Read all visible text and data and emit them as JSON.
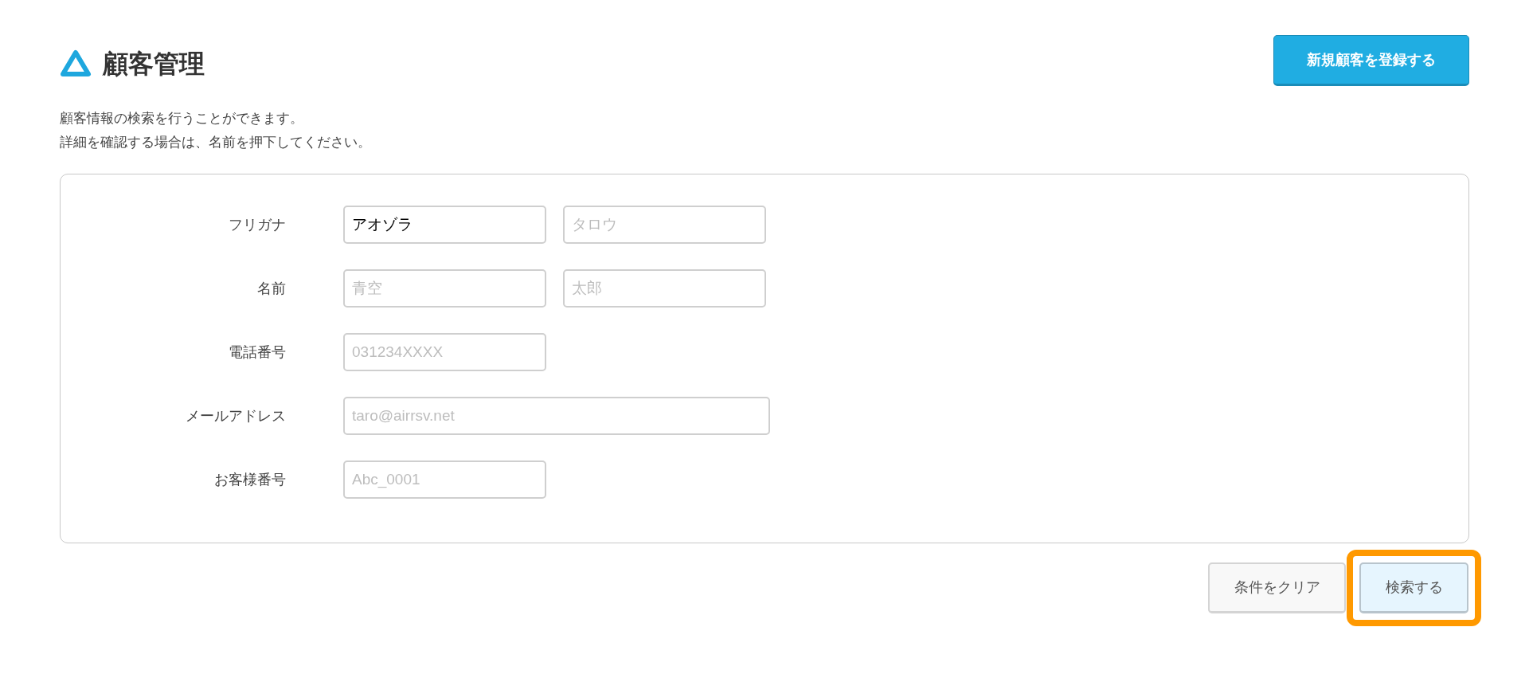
{
  "header": {
    "title": "顧客管理",
    "primary_button": "新規顧客を登録する"
  },
  "description": [
    "顧客情報の検索を行うことができます。",
    "詳細を確認する場合は、名前を押下してください。"
  ],
  "search_form": {
    "fields": [
      {
        "label": "フリガナ",
        "inputs": [
          {
            "value": "アオゾラ"
          },
          {
            "placeholder": "タロウ"
          }
        ]
      },
      {
        "label": "名前",
        "inputs": [
          {
            "placeholder": "青空"
          },
          {
            "placeholder": "太郎"
          }
        ]
      },
      {
        "label": "電話番号",
        "inputs": [
          {
            "placeholder": "031234XXXX"
          }
        ]
      },
      {
        "label": "メールアドレス",
        "inputs": [
          {
            "placeholder": "taro@airrsv.net",
            "wide": true
          }
        ]
      },
      {
        "label": "お客様番号",
        "inputs": [
          {
            "placeholder": "Abc_0001"
          }
        ]
      }
    ]
  },
  "actions": [
    {
      "kind": "secondary",
      "label": "条件をクリア",
      "highlighted": false
    },
    {
      "kind": "primary",
      "label": "検索する",
      "highlighted": true
    }
  ]
}
